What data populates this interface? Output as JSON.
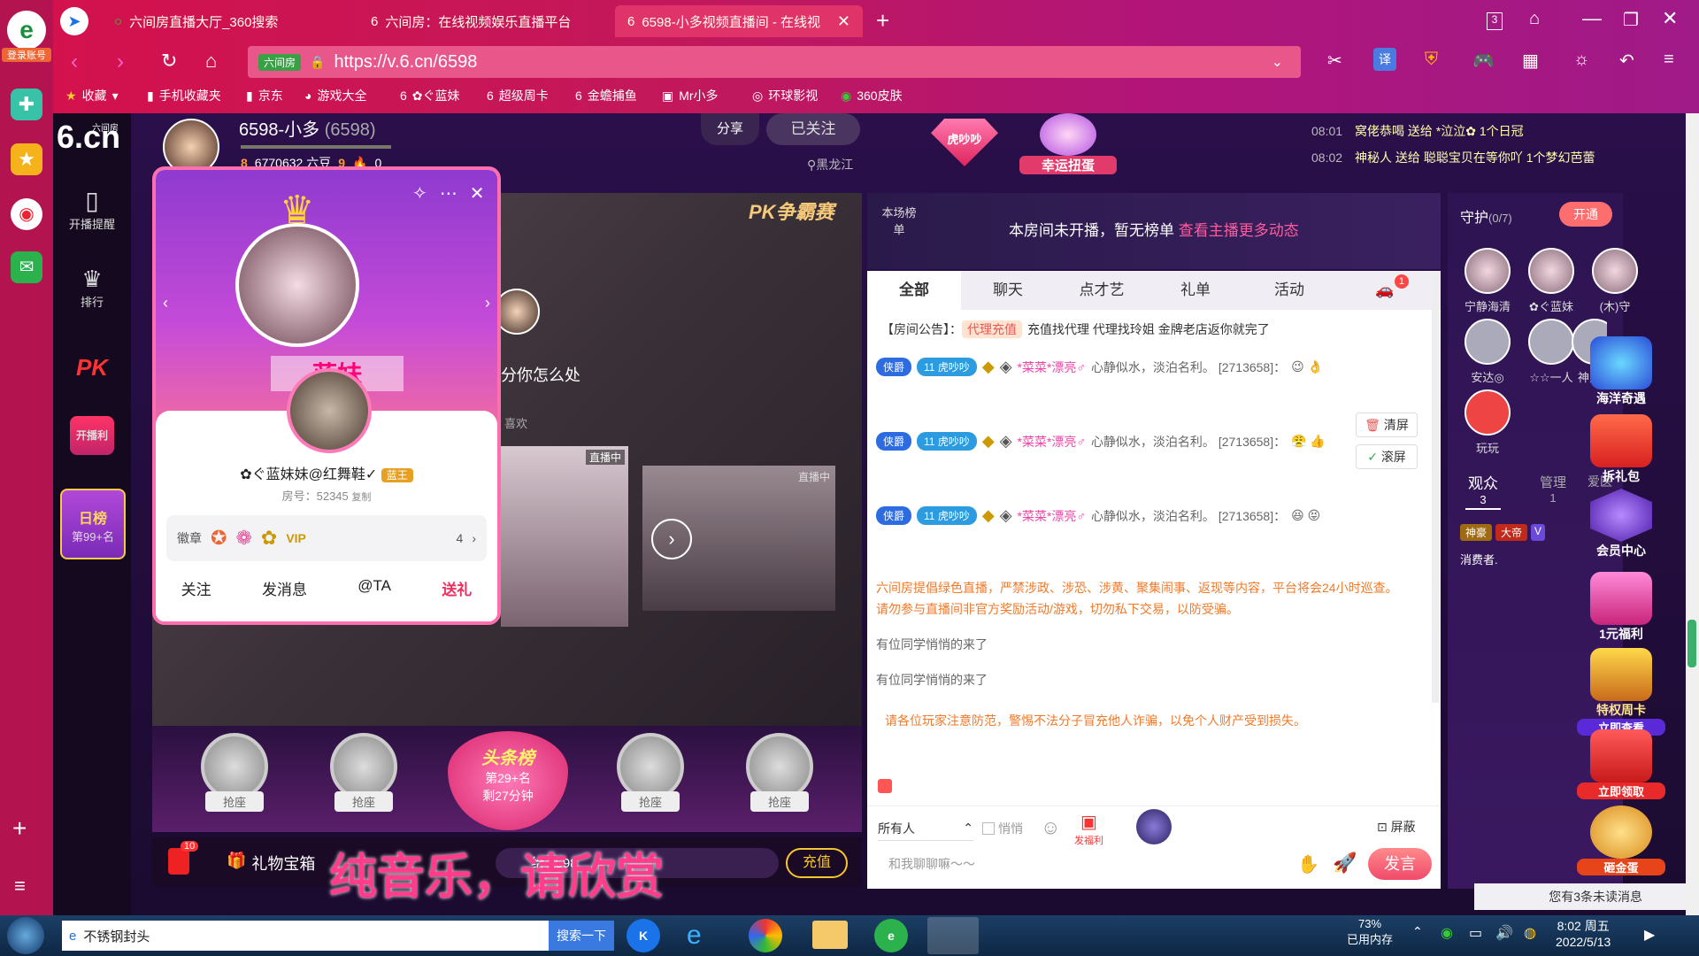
{
  "browser": {
    "login_label": "登录账号",
    "tabs": [
      {
        "title": "六间房直播大厅_360搜索"
      },
      {
        "title": "六间房：在线视频娱乐直播平台"
      },
      {
        "title": "6598-小多视频直播间 - 在线视"
      }
    ],
    "new_tab": "+",
    "window_badge": "3",
    "url_badge": "六间房",
    "url": "https://v.6.cn/6598",
    "translate": "译",
    "bookmarks": [
      "收藏",
      "手机收藏夹",
      "京东",
      "游戏大全",
      "✿ぐ蓝妹",
      "超级周卡",
      "金蟾捕鱼",
      "Mr小多",
      "环球影视",
      "360皮肤"
    ]
  },
  "site_nav": {
    "logo_main": "6.cn",
    "logo_sub": "六间房",
    "items": [
      "开播提醒",
      "排行",
      "PK",
      "开播利",
      "日榜"
    ],
    "rank_label": "第99+名"
  },
  "host": {
    "name": "6598-小多",
    "id": "(6598)",
    "level": "8",
    "beans": "6770632 六豆",
    "level2": "9",
    "fire": "0",
    "location": "黑龙江",
    "share": "分享",
    "followed": "已关注",
    "tag": "虎吵吵",
    "lucky": "幸运扭蛋"
  },
  "gift_feed": [
    {
      "time": "08:01",
      "text": "窝佬恭喝 送给 *泣泣✿ 1个日冠"
    },
    {
      "time": "08:02",
      "text": "神秘人 送给 聪聪宝贝在等你吖 1个梦幻芭蕾"
    }
  ],
  "pk_label": "PK争霸赛",
  "video": {
    "caption": "分你怎么处",
    "like_label": "喜欢",
    "live_badge": "直播中",
    "banner": "纯音乐，请欣赏"
  },
  "profile_card": {
    "name": "✿ぐ蓝妹妹@红舞鞋✓",
    "badge": "蓝王",
    "room_no": "房号：52345",
    "copy": "复制",
    "medal_label": "徽章",
    "medal_count": "4",
    "actions": [
      "关注",
      "发消息",
      "@TA",
      "送礼"
    ],
    "blur_name": "蓝妹"
  },
  "seats": [
    "抢座",
    "抢座",
    "抢座",
    "抢座"
  ],
  "headline": {
    "title": "头条榜",
    "rank": "第29+名",
    "remain": "剩27分钟"
  },
  "bottom_bar": {
    "badge": "10",
    "treasure": "礼物宝箱",
    "send_to": "给 6598",
    "recharge": "充值"
  },
  "rank_panel": {
    "label": "本场榜单",
    "empty": "本房间未开播，暂无榜单",
    "link": "查看主播更多动态"
  },
  "chat_tabs": [
    "全部",
    "聊天",
    "点才艺",
    "礼单",
    "活动"
  ],
  "car_badge": "1",
  "notice": {
    "label": "【房间公告】：",
    "tag": "代理充值",
    "text": "充值找代理 代理找玲姐 金牌老店返你就完了"
  },
  "messages": [
    {
      "badge": "侠爵",
      "lvl": "11",
      "tag": "虎吵吵",
      "user": "*菜菜*漂亮♂",
      "text": "心静似水，淡泊名利。 [2713658]：",
      "emoji": "😉 👌"
    },
    {
      "badge": "侠爵",
      "lvl": "11",
      "tag": "虎吵吵",
      "user": "*菜菜*漂亮♂",
      "text": "心静似水，淡泊名利。 [2713658]：",
      "emoji": "😤 👍"
    },
    {
      "badge": "侠爵",
      "lvl": "11",
      "tag": "虎吵吵",
      "user": "*菜菜*漂亮♂",
      "text": "心静似水，淡泊名利。 [2713658]：",
      "emoji": "😆 😝"
    }
  ],
  "system_msg": "六间房提倡绿色直播，严禁涉政、涉恐、涉黄、聚集闹事、返现等内容，平台将会24小时巡查。请勿参与直播间非官方奖励活动/游戏，切勿私下交易，以防受骗。",
  "joins": [
    "有位同学悄悄的来了",
    "有位同学悄悄的来了"
  ],
  "warning": "请各位玩家注意防范，警惕不法分子冒充他人诈骗，以免个人财产受到损失。",
  "chat_tools": {
    "clear": "清屏",
    "scroll": "滚屏",
    "target": "所有人",
    "whisper": "悄悄",
    "fuli": "发福利",
    "block": "屏蔽",
    "placeholder": "和我聊聊嘛～～",
    "send": "发言"
  },
  "guard": {
    "title": "守护",
    "count": "(0/7)",
    "open": "开通",
    "members": [
      "宁静海清",
      "✿ぐ蓝妹",
      "(木)守",
      "安达◎",
      "☆☆一人",
      "神鬼",
      "玩玩"
    ],
    "tabs": [
      {
        "label": "观众",
        "count": "3"
      },
      {
        "label": "管理",
        "count": "1"
      },
      {
        "label": "爱医",
        "count": ""
      }
    ],
    "viewer_badges": [
      "神豪",
      "大帝",
      "V"
    ],
    "viewer_name": "消费者."
  },
  "promos": [
    "海洋奇遇",
    "拆礼包",
    "会员中心",
    "1元福利",
    "特权周卡",
    "立即查看",
    "立即领取",
    "砸金蛋"
  ],
  "unread": "您有3条未读消息",
  "taskbar": {
    "search_text": "不锈钢封头",
    "search_btn": "搜索一下",
    "mem": "73%",
    "mem_label": "已用内存",
    "time": "8:02 周五",
    "date": "2022/5/13"
  }
}
